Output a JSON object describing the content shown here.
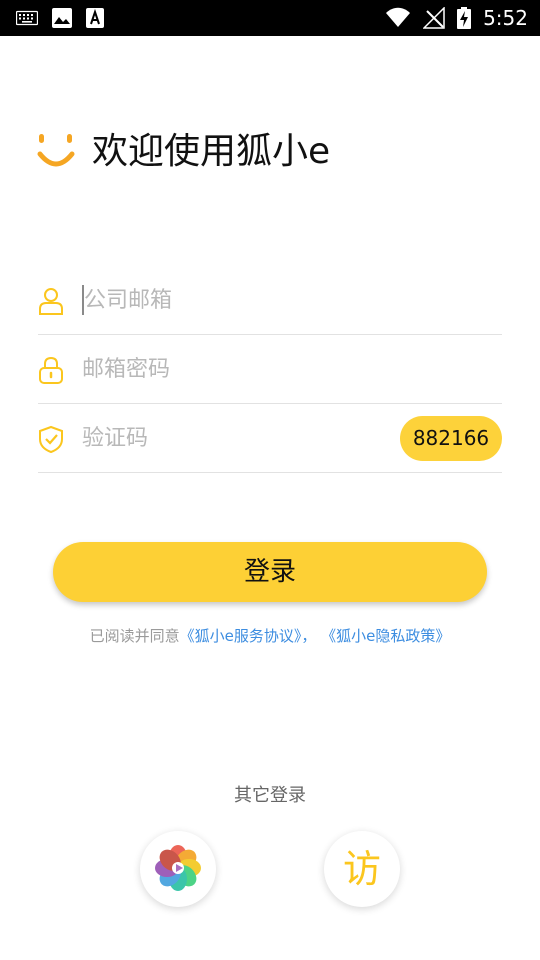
{
  "status_bar": {
    "time": "5:52",
    "left_icons": [
      "keyboard-icon",
      "image-icon",
      "font-icon"
    ],
    "right_icons": [
      "wifi-icon",
      "no-signal-icon",
      "battery-charging-icon"
    ]
  },
  "welcome": {
    "title": "欢迎使用狐小e",
    "logo_icon": "smile-logo-icon"
  },
  "form": {
    "email": {
      "placeholder": "公司邮箱",
      "value": "",
      "icon": "user-icon"
    },
    "password": {
      "placeholder": "邮箱密码",
      "value": "",
      "icon": "lock-icon"
    },
    "code": {
      "placeholder": "验证码",
      "value": "",
      "icon": "shield-check-icon",
      "captcha_button": "882166"
    }
  },
  "login_button": "登录",
  "agreement": {
    "prefix": "已阅读并同意",
    "service_link": "《狐小e服务协议》",
    "separator": "，",
    "privacy_link": "《狐小e隐私政策》"
  },
  "other_login": {
    "title": "其它登录",
    "options": [
      {
        "icon": "flower-app-icon"
      },
      {
        "label": "访",
        "icon": "visitor-icon"
      }
    ]
  },
  "colors": {
    "accent": "#fdd035",
    "icon_yellow": "#fbc61e",
    "link_blue": "#3d8de0",
    "placeholder": "#b8b8b8"
  }
}
